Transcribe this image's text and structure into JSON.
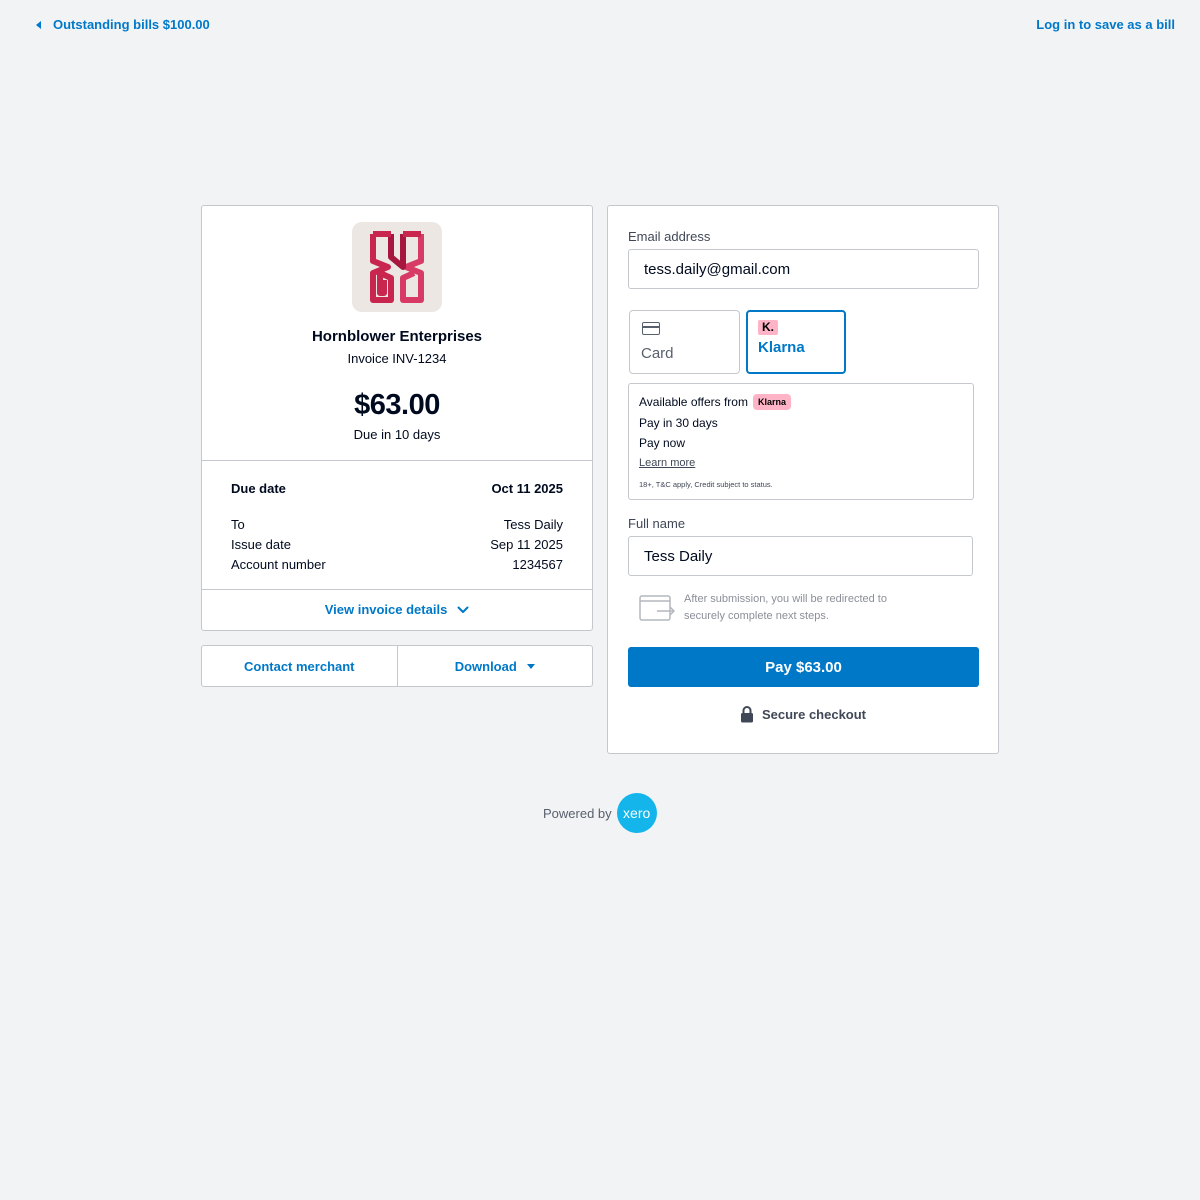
{
  "topbar": {
    "back_label": "Outstanding bills $100.00",
    "login_label": "Log in to save as a bill"
  },
  "invoice": {
    "merchant_name": "Hornblower Enterprises",
    "invoice_number": "Invoice INV-1234",
    "amount": "$63.00",
    "due_in": "Due in 10 days",
    "due_date_label": "Due date",
    "due_date_value": "Oct 11 2025",
    "details": [
      {
        "label": "To",
        "value": "Tess Daily"
      },
      {
        "label": "Issue date",
        "value": "Sep 11 2025"
      },
      {
        "label": "Account number",
        "value": "1234567"
      }
    ],
    "view_details_label": "View invoice details",
    "logo_colors": [
      "#c8264f",
      "#a6163f"
    ]
  },
  "actions": {
    "contact_label": "Contact merchant",
    "download_label": "Download"
  },
  "payment": {
    "email_label": "Email address",
    "email_value": "tess.daily@gmail.com",
    "methods": [
      {
        "label": "Card",
        "icon": "credit-card-icon",
        "selected": false
      },
      {
        "label": "Klarna",
        "icon": "klarna-logo-icon",
        "mark": "K.",
        "selected": true
      }
    ],
    "offers": {
      "heading": "Available offers from",
      "badge": "Klarna",
      "items": [
        "Pay in 30 days",
        "Pay now"
      ],
      "learn_more": "Learn more",
      "fine_print": "18+, T&C apply, Credit subject to status."
    },
    "full_name_label": "Full name",
    "full_name_value": "Tess Daily",
    "redirect_note": "After submission, you will be redirected to securely complete next steps.",
    "pay_label": "Pay $63.00",
    "secure_label": "Secure checkout"
  },
  "footer": {
    "powered_by": "Powered by",
    "brand": "xero"
  },
  "colors": {
    "accent": "#0078c8",
    "background": "#f2f3f5",
    "klarna_pink": "#ffb3c7",
    "xero_blue": "#13b5ea"
  }
}
